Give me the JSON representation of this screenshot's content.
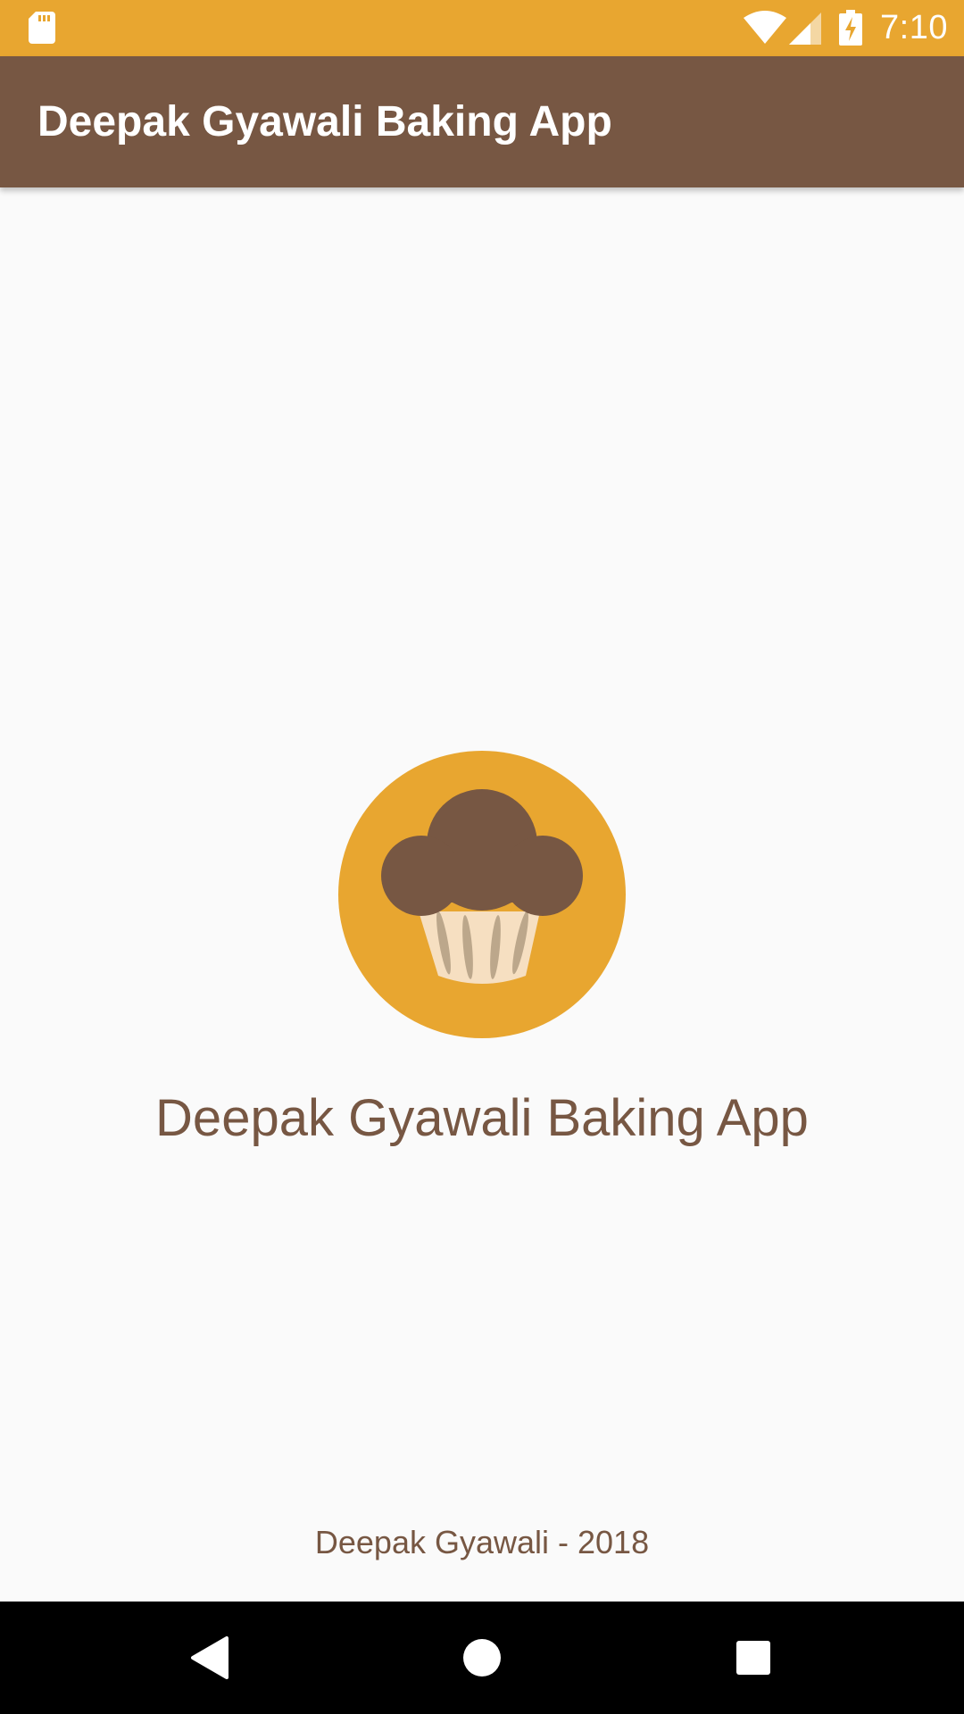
{
  "status_bar": {
    "time": "7:10",
    "icons": [
      "sd-card-icon",
      "wifi-icon",
      "signal-icon",
      "battery-charging-icon"
    ]
  },
  "app_bar": {
    "title": "Deepak Gyawali Baking App"
  },
  "main": {
    "logo_icon": "cupcake-icon",
    "title": "Deepak Gyawali Baking App",
    "footer": "Deepak Gyawali - 2018"
  },
  "nav_bar": {
    "icons": [
      "back-icon",
      "home-icon",
      "recents-icon"
    ]
  },
  "colors": {
    "status_bar": "#e8a630",
    "app_bar": "#775743",
    "background": "#fafafa",
    "accent_text": "#775743",
    "logo_circle": "#e8a630",
    "muffin_top": "#775743",
    "muffin_liner": "#f6dfc1"
  }
}
